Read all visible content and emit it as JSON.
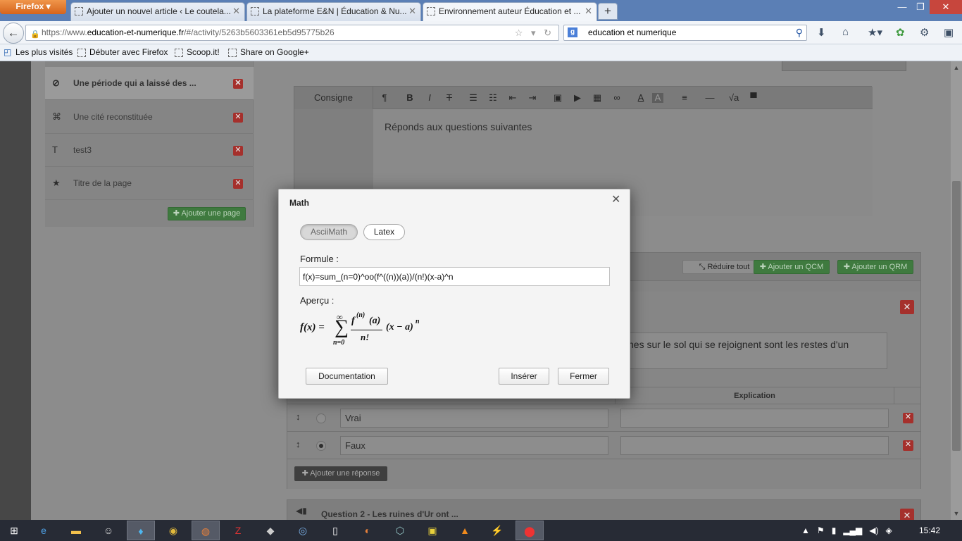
{
  "browser": {
    "app_button": "Firefox",
    "tabs": [
      {
        "title": "Ajouter un nouvel article ‹ Le coutela..."
      },
      {
        "title": "La plateforme E&N | Éducation & Nu..."
      },
      {
        "title": "Environnement auteur Éducation et ..."
      }
    ],
    "url_prefix": "https://www.",
    "url_domain": "education-et-numerique.fr",
    "url_path": "/#/activity/5263b5603361eb5d95775b26",
    "search_value": "education et numerique",
    "bookmarks": [
      "Les plus visités",
      "Débuter avec Firefox",
      "Scoop.it!",
      "Share on Google+"
    ]
  },
  "sidebar": {
    "pages": [
      {
        "title": "Une période qui a laissé des ...",
        "icon": "check-circle-icon"
      },
      {
        "title": "Une cité reconstituée",
        "icon": "expand-icon"
      },
      {
        "title": "test3",
        "icon": "text-icon"
      },
      {
        "title": "Titre de la page",
        "icon": "star-icon"
      }
    ],
    "add_page": "Ajouter une page"
  },
  "editor": {
    "label": "Consigne",
    "toolbar": [
      "¶",
      "B",
      "I",
      "T",
      "☰",
      "☷",
      "⇤",
      "⇥",
      "▣",
      "▶",
      "▦",
      "∞",
      "A",
      "A",
      "≡",
      "—",
      "√a",
      "▀"
    ],
    "body": "Réponds aux questions suivantes"
  },
  "questions": {
    "reduce_all": "Réduire tout",
    "add_qcm": "Ajouter un QCM",
    "add_qrm": "Ajouter un QRM",
    "q1_text": "nes sur le sol qui se rejoignent sont les restes d'un",
    "explication_header": "Explication",
    "answers": [
      {
        "text": "Vrai",
        "checked": false
      },
      {
        "text": "Faux",
        "checked": true
      }
    ],
    "add_answer": "Ajouter une réponse",
    "q2_title": "Question 2 - Les ruines d'Ur ont ..."
  },
  "modal": {
    "title": "Math",
    "mode_ascii": "AsciiMath",
    "mode_latex": "Latex",
    "formule_label": "Formule :",
    "formula_value": "f(x)=sum_(n=0)^oo(f^((n))(a))/(n!)(x-a)^n",
    "apercu_label": "Aperçu :",
    "preview": {
      "lhs": "f(x) =",
      "sigma": "∑",
      "upper": "∞",
      "lower": "n=0",
      "num": "f",
      "num_sup": "(n)",
      "num_arg": "(a)",
      "den": "n!",
      "rhs": "(x − a)",
      "rhs_sup": "n"
    },
    "btn_doc": "Documentation",
    "btn_insert": "Insérer",
    "btn_close": "Fermer"
  },
  "taskbar": {
    "clock": "15:42"
  }
}
